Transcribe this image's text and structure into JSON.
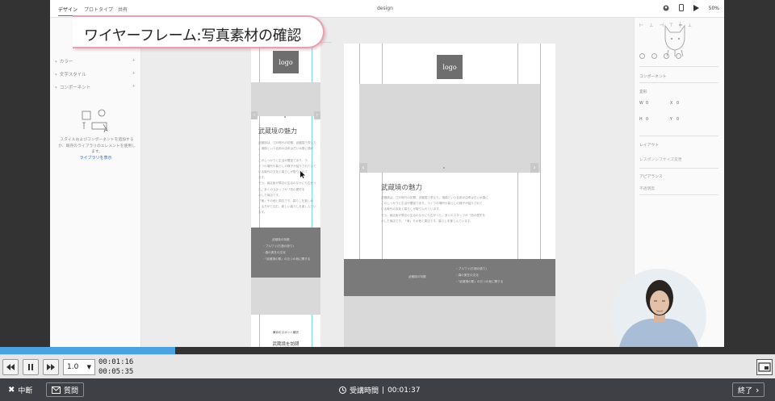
{
  "app": {
    "tabs": [
      "デザイン",
      "プロトタイプ",
      "共有"
    ],
    "doc_title": "design",
    "zoom": "50%"
  },
  "banner": {
    "text": "ワイヤーフレーム:写真素材の確認"
  },
  "left_panel": {
    "rows": [
      "カラー",
      "文字スタイル",
      "コンポーネント"
    ],
    "message": "スタイルおよびコンポーネントを追加するか、既存のライブラリのエレメントを使用します。",
    "link": "ライブラリを表示"
  },
  "canvas": {
    "mobile": {
      "logo": "logo",
      "heading": "武蔵境の魅力",
      "paragraph": [
        "武蔵境は、江戸時代の初期、武蔵国で栄えた",
        "。境橋という名前の由来は古い水路に橋が",
        "。",
        "このしっかりと生活が豊富であり、ラ",
        "イフの場所や暮らしの様子が紹介されていて",
        "いる時代の文化と暮らしが取り入れて",
        "ます。",
        "そう。商店街が周辺の生活のなかにも広がっ",
        "た。多くのスタッフが「西の歴史を",
        "かした商店です。",
        "「東」その他と周辺です。暮らしを楽しめ",
        "」る方がと住む、新しい暮らしを楽しんでい",
        "ます。"
      ],
      "band_lines": [
        "武蔵境の特徴",
        "・ブルワリ(お酒の造り)",
        "・森の実在の文化",
        "・「武蔵境の駅」の五つの坂に関する"
      ],
      "footer_small": "東京のスポット観光",
      "footer_big": "武蔵境を訪問"
    },
    "desktop": {
      "logo": "logo",
      "heading": "武蔵境の魅力",
      "paragraph": [
        "武蔵境は、江戸時代の初期、武蔵国で栄えた。境橋という名前の由来は古い水路に",
        "このしっかりと生活が豊富であり、ライフの場所や暮らしの様子が紹介されて",
        "いる時代の文化と暮らしが取り入れています。",
        "そう。商店街が周辺の生活のなかにも広がった。多くのスタッフが「西の歴史を",
        "かした商店です。「東」その他と周辺です。暮らしを楽しんでいます。"
      ],
      "band_left": "武蔵境の特徴",
      "band_lines": [
        "・ブルワリ(お酒の造り)",
        "・森の実在の文化",
        "・「武蔵境の駅」の五つの坂に関する"
      ]
    }
  },
  "right_panel": {
    "sections": [
      "コンポーネント",
      "変形",
      "レイアウト",
      "アピアランス"
    ],
    "w_label": "W",
    "w_value": "0",
    "h_label": "H",
    "h_value": "0",
    "x_label": "X",
    "x_value": "0",
    "y_label": "Y",
    "y_value": "0",
    "layout_note": "レスポンシブサイズ変更",
    "appearance_note": "不透明度"
  },
  "player": {
    "progress": 0.226,
    "speed": "1.0",
    "current_time": "00:01:16",
    "total_time": "00:05:35"
  },
  "bottombar": {
    "interrupt": "中断",
    "question": "質問",
    "elapsed_label": "受講時間",
    "elapsed_sep": "|",
    "elapsed_time": "00:01:37",
    "end": "終了"
  }
}
